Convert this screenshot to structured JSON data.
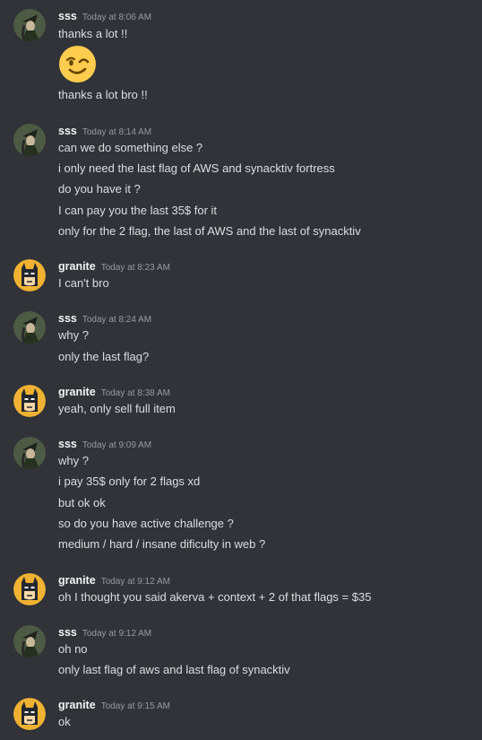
{
  "messages": [
    {
      "user": "sss",
      "time": "Today at 8:06 AM",
      "lines": [
        "thanks a lot !!",
        "thanks a lot bro !!"
      ],
      "emoji": "winking-face-emoji"
    },
    {
      "user": "sss",
      "time": "Today at 8:14 AM",
      "lines": [
        "can we do something else ?",
        "i only need the last flag of AWS and synacktiv fortress",
        "do you have it ?",
        "I can pay you the last 35$ for it",
        "only for the 2 flag, the last of AWS and the last of synacktiv"
      ]
    },
    {
      "user": "granite",
      "time": "Today at 8:23 AM",
      "lines": [
        "I can't bro"
      ]
    },
    {
      "user": "sss",
      "time": "Today at 8:24 AM",
      "lines": [
        "why ?",
        "only the last flag?"
      ]
    },
    {
      "user": "granite",
      "time": "Today at 8:38 AM",
      "lines": [
        "yeah, only sell full item"
      ]
    },
    {
      "user": "sss",
      "time": "Today at 9:09 AM",
      "lines": [
        "why ?",
        "i pay 35$ only for 2 flags xd",
        "but ok ok",
        "so do you have active challenge ?",
        "medium / hard / insane dificulty in web ?"
      ]
    },
    {
      "user": "granite",
      "time": "Today at 9:12 AM",
      "lines": [
        "oh I thought you said akerva + context + 2 of that flags = $35"
      ]
    },
    {
      "user": "sss",
      "time": "Today at 9:12 AM",
      "lines": [
        "oh no",
        "only last flag of aws and last flag of synacktiv"
      ]
    },
    {
      "user": "granite",
      "time": "Today at 9:15 AM",
      "lines": [
        "ok"
      ]
    }
  ],
  "colors": {
    "background": "#313338",
    "username": "#f2f3f5",
    "timestamp": "#949ba4",
    "message_text": "#dbdee1",
    "granite_avatar_bg": "#f0b232"
  },
  "icons": {
    "sss_avatar": "witch-avatar-icon",
    "granite_avatar": "batman-avatar-icon"
  }
}
